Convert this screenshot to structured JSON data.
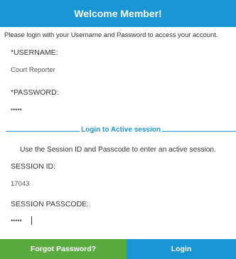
{
  "header": {
    "title": "Welcome Member!"
  },
  "intro": {
    "text": "Please login with your Username and Password to access your account."
  },
  "username": {
    "label": "*USERNAME:",
    "value": "Court Reporter"
  },
  "password": {
    "label": "*PASSWORD:",
    "value": "•••••"
  },
  "session": {
    "divider_label": "Login to Active session",
    "instructions": "Use the Session ID and Passcode to enter an active session.",
    "id_label": "SESSION ID:",
    "id_value": "17043",
    "passcode_label": "SESSION PASSCODE:",
    "passcode_value": "•••••"
  },
  "buttons": {
    "forgot": "Forgot Password?",
    "login": "Login"
  },
  "colors": {
    "header": "#1a96d4",
    "forgot_button": "#5aab3f",
    "login_button": "#1a96d4",
    "accent_text": "#1a96d4"
  }
}
